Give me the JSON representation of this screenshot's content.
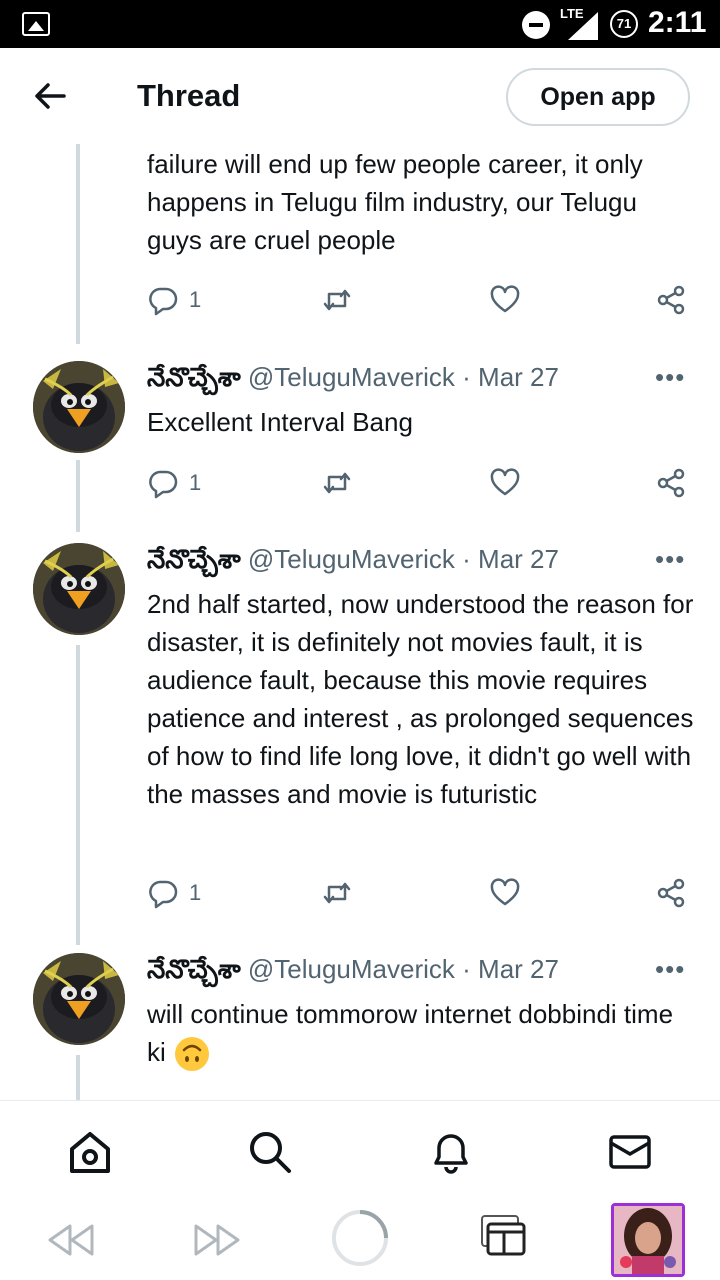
{
  "status_bar": {
    "network": "LTE",
    "battery": "71",
    "time": "2:11"
  },
  "header": {
    "title": "Thread",
    "open_app_label": "Open app"
  },
  "tweets": [
    {
      "text": "failure will end up few people career, it only happens in Telugu film industry, our Telugu guys are cruel people",
      "reply_count": "1"
    },
    {
      "name": "నేనొచ్చేశా",
      "handle": "@TeluguMaverick",
      "date": "Mar 27",
      "text": "Excellent Interval Bang",
      "reply_count": "1"
    },
    {
      "name": "నేనొచ్చేశా",
      "handle": "@TeluguMaverick",
      "date": "Mar 27",
      "text": "2nd half started, now understood the reason for disaster, it is definitely not movies fault, it is audience fault, because this movie requires patience and interest , as prolonged sequences of how to find life long love, it didn't go well with the masses and movie is futuristic",
      "reply_count": "1"
    },
    {
      "name": "నేనొచ్చేశా",
      "handle": "@TeluguMaverick",
      "date": "Mar 27",
      "text": "will continue tommorow internet dobbindi time ki"
    }
  ],
  "separator": "·",
  "more_glyph": "•••",
  "icons": {
    "back": "arrow-left-icon",
    "reply": "reply-bubble-icon",
    "retweet": "retweet-icon",
    "like": "heart-icon",
    "share": "share-icon",
    "home": "home-icon",
    "search": "search-icon",
    "notifications": "bell-icon",
    "messages": "mail-icon",
    "emoji": "upside-down-face-emoji"
  },
  "colors": {
    "text": "#0f1419",
    "muted": "#536471",
    "thread_line": "#cfd9de",
    "tab_highlight": "#9b30d9"
  }
}
